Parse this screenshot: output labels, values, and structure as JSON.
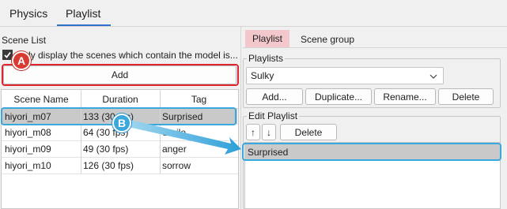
{
  "tabs": [
    {
      "label": "Physics"
    },
    {
      "label": "Playlist"
    }
  ],
  "scene_list": {
    "title": "Scene List",
    "checkbox_label": "Only display the scenes which contain the model is...",
    "checkbox_checked": true,
    "add_label": "Add",
    "columns": [
      "Scene Name",
      "Duration",
      "Tag"
    ],
    "rows": [
      {
        "name": "hiyori_m07",
        "duration": "133 (30 fps)",
        "tag": "Surprised"
      },
      {
        "name": "hiyori_m08",
        "duration": "64 (30 fps)",
        "tag": "Smile"
      },
      {
        "name": "hiyori_m09",
        "duration": "49 (30 fps)",
        "tag": "anger"
      },
      {
        "name": "hiyori_m10",
        "duration": "126 (30 fps)",
        "tag": "sorrow"
      }
    ]
  },
  "right_tabs": [
    {
      "label": "Playlist"
    },
    {
      "label": "Scene group"
    }
  ],
  "playlists": {
    "title": "Playlists",
    "selected": "Sulky",
    "buttons": [
      "Add...",
      "Duplicate...",
      "Rename...",
      "Delete"
    ]
  },
  "edit_playlist": {
    "title": "Edit Playlist",
    "up_label": "↑",
    "down_label": "↓",
    "delete_label": "Delete",
    "items": [
      "Surprised"
    ]
  },
  "annotations": {
    "a": "A",
    "b": "B"
  },
  "colors": {
    "accent": "#2f6fc7",
    "annotation_red": "#d93a32",
    "annotation_blue": "#3aa7dd",
    "selection": "#c9c9c9",
    "active_tab_bg": "#f2c8cc"
  }
}
